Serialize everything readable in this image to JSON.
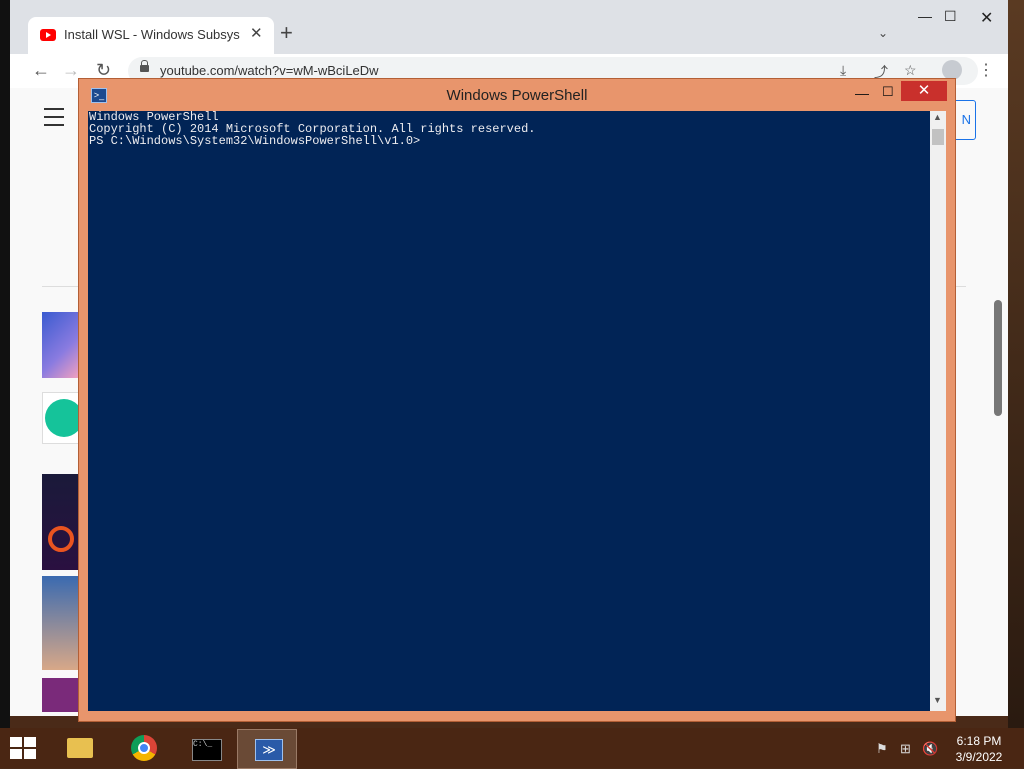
{
  "browser": {
    "tab_title": "Install WSL - Windows Subsystem",
    "tab_close": "✕",
    "new_tab": "+",
    "tab_dropdown": "⌄",
    "window_min": "—",
    "window_max": "☐",
    "window_close": "✕",
    "back": "←",
    "forward": "→",
    "reload": "↻",
    "url": "youtube.com/watch?v=wM-wBciLeDw",
    "install_icon": "⤓",
    "share_icon": "⤴",
    "star_icon": "☆",
    "menu": "⋮"
  },
  "youtube": {
    "signin_partial": "N"
  },
  "powershell": {
    "title": "Windows PowerShell",
    "icon_glyph": ">_",
    "min": "—",
    "max": "☐",
    "close": "✕",
    "lines": [
      "Windows PowerShell",
      "Copyright (C) 2014 Microsoft Corporation. All rights reserved.",
      "",
      "PS C:\\Windows\\System32\\WindowsPowerShell\\v1.0>"
    ],
    "scroll_up": "▲",
    "scroll_down": "▼"
  },
  "taskbar": {
    "cmd_glyph": "C:\\_",
    "ps_glyph": "≫",
    "tray": [
      "⚑",
      "⊞",
      "🔇"
    ],
    "time": "6:18 PM",
    "date": "3/9/2022"
  },
  "colors": {
    "console_bg": "#012456",
    "ps_frame": "#e8956c",
    "taskbar": "#4a2613",
    "close_red": "#c9302c"
  }
}
